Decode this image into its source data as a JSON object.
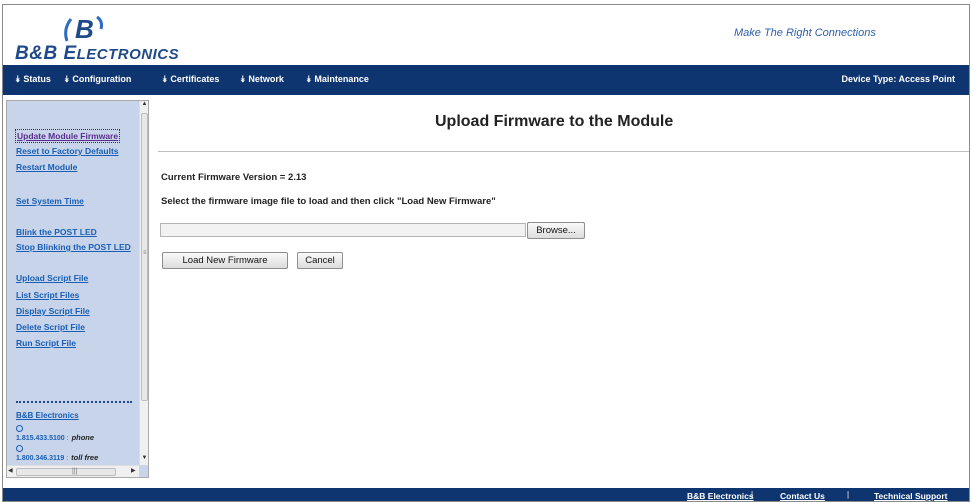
{
  "brand": {
    "logo_text_main": "B&B E",
    "logo_text_rest": "LECTRONICS",
    "tagline": "Make The Right Connections"
  },
  "nav": {
    "items": [
      {
        "label": "Status"
      },
      {
        "label": "Configuration"
      },
      {
        "label": "Certificates"
      },
      {
        "label": "Network"
      },
      {
        "label": "Maintenance"
      }
    ],
    "device_type": "Device Type: Access Point"
  },
  "sidebar": {
    "links": [
      {
        "label": "Update Module Firmware",
        "active": true
      },
      {
        "label": "Reset to Factory Defaults"
      },
      {
        "label": "Restart Module"
      },
      {
        "label": "Set System Time"
      },
      {
        "label": "Blink the POST LED"
      },
      {
        "label": "Stop Blinking the POST LED"
      },
      {
        "label": "Upload Script File"
      },
      {
        "label": "List Script Files"
      },
      {
        "label": "Display Script File"
      },
      {
        "label": "Delete Script File"
      },
      {
        "label": "Run Script File"
      }
    ],
    "contact": {
      "title": "B&B Electronics",
      "phones": [
        {
          "number": "1.815.433.5100",
          "kind": "phone"
        },
        {
          "number": "1.800.346.3119",
          "kind": "toll free"
        }
      ]
    },
    "scroll_grip": "|||"
  },
  "main": {
    "title": "Upload Firmware to the Module",
    "firmware_version": "Current Firmware Version = 2.13",
    "instruction": "Select the firmware image file to load and then click \"Load New Firmware\"",
    "browse_label": "Browse...",
    "load_label": "Load New Firmware",
    "cancel_label": "Cancel"
  },
  "footer": {
    "links": [
      {
        "label": "B&B Electronics"
      },
      {
        "label": "Contact Us"
      },
      {
        "label": "Technical Support"
      }
    ],
    "separator": "|"
  },
  "colors": {
    "nav_bg": "#0f3570",
    "sidebar_bg": "#c7d4ea",
    "link": "#1a5fb4",
    "brand_blue": "#1f4a8a"
  }
}
